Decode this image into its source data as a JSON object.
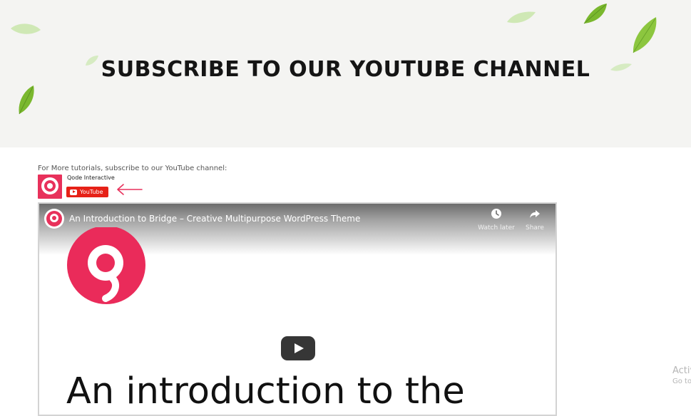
{
  "hero": {
    "title": "SUBSCRIBE TO OUR YOUTUBE CHANNEL",
    "leaf_color": "#7ab82e"
  },
  "subscribe": {
    "intro": "For More tutorials, subscribe to our YouTube channel:",
    "channel_name": "Qode Interactive",
    "button_label": "YouTube",
    "brand_color": "#e8315b",
    "youtube_red": "#e62117"
  },
  "video": {
    "title": "An Introduction to Bridge – Creative Multipurpose WordPress Theme",
    "watch_later_label": "Watch later",
    "share_label": "Share",
    "slide_heading": "An introduction to the",
    "icons": [
      "clock-icon",
      "share-icon",
      "play-icon"
    ]
  },
  "watermark": {
    "title": "Activ",
    "subtitle": "Go to"
  }
}
